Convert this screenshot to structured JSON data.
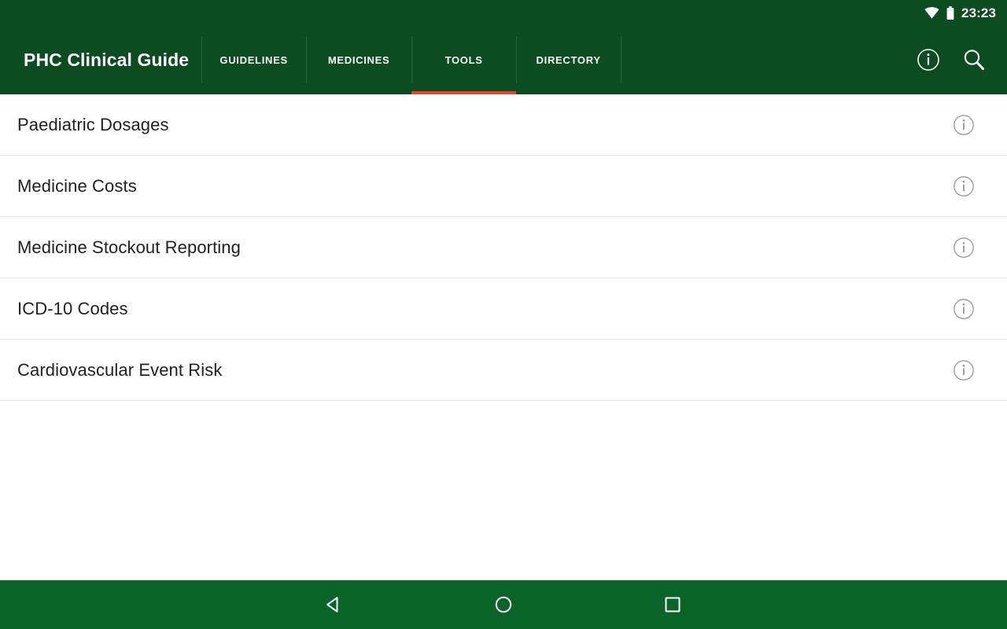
{
  "status_bar": {
    "time": "23:23",
    "wifi_icon": "wifi-icon",
    "battery_icon": "battery-icon",
    "background_color": "#0b4c20"
  },
  "app_bar": {
    "title": "PHC Clinical Guide",
    "background_color": "#0b4c20",
    "accent_color": "#e8412f",
    "tabs": [
      {
        "label": "GUIDELINES",
        "active": false
      },
      {
        "label": "MEDICINES",
        "active": false
      },
      {
        "label": "TOOLS",
        "active": true
      },
      {
        "label": "DIRECTORY",
        "active": false
      }
    ],
    "actions": [
      {
        "name": "info-icon",
        "label": "Info"
      },
      {
        "name": "search-icon",
        "label": "Search"
      }
    ]
  },
  "tools_list": {
    "items": [
      {
        "label": "Paediatric Dosages",
        "info_icon": "info-circle-icon"
      },
      {
        "label": "Medicine Costs",
        "info_icon": "info-circle-icon"
      },
      {
        "label": "Medicine Stockout Reporting",
        "info_icon": "info-circle-icon"
      },
      {
        "label": "ICD-10 Codes",
        "info_icon": "info-circle-icon"
      },
      {
        "label": "Cardiovascular Event Risk",
        "info_icon": "info-circle-icon"
      }
    ]
  },
  "navigation_bar": {
    "background_color": "#0a6329",
    "buttons": [
      {
        "name": "back-button",
        "icon": "triangle-left-icon"
      },
      {
        "name": "home-button",
        "icon": "circle-icon"
      },
      {
        "name": "recents-button",
        "icon": "square-icon"
      }
    ]
  }
}
